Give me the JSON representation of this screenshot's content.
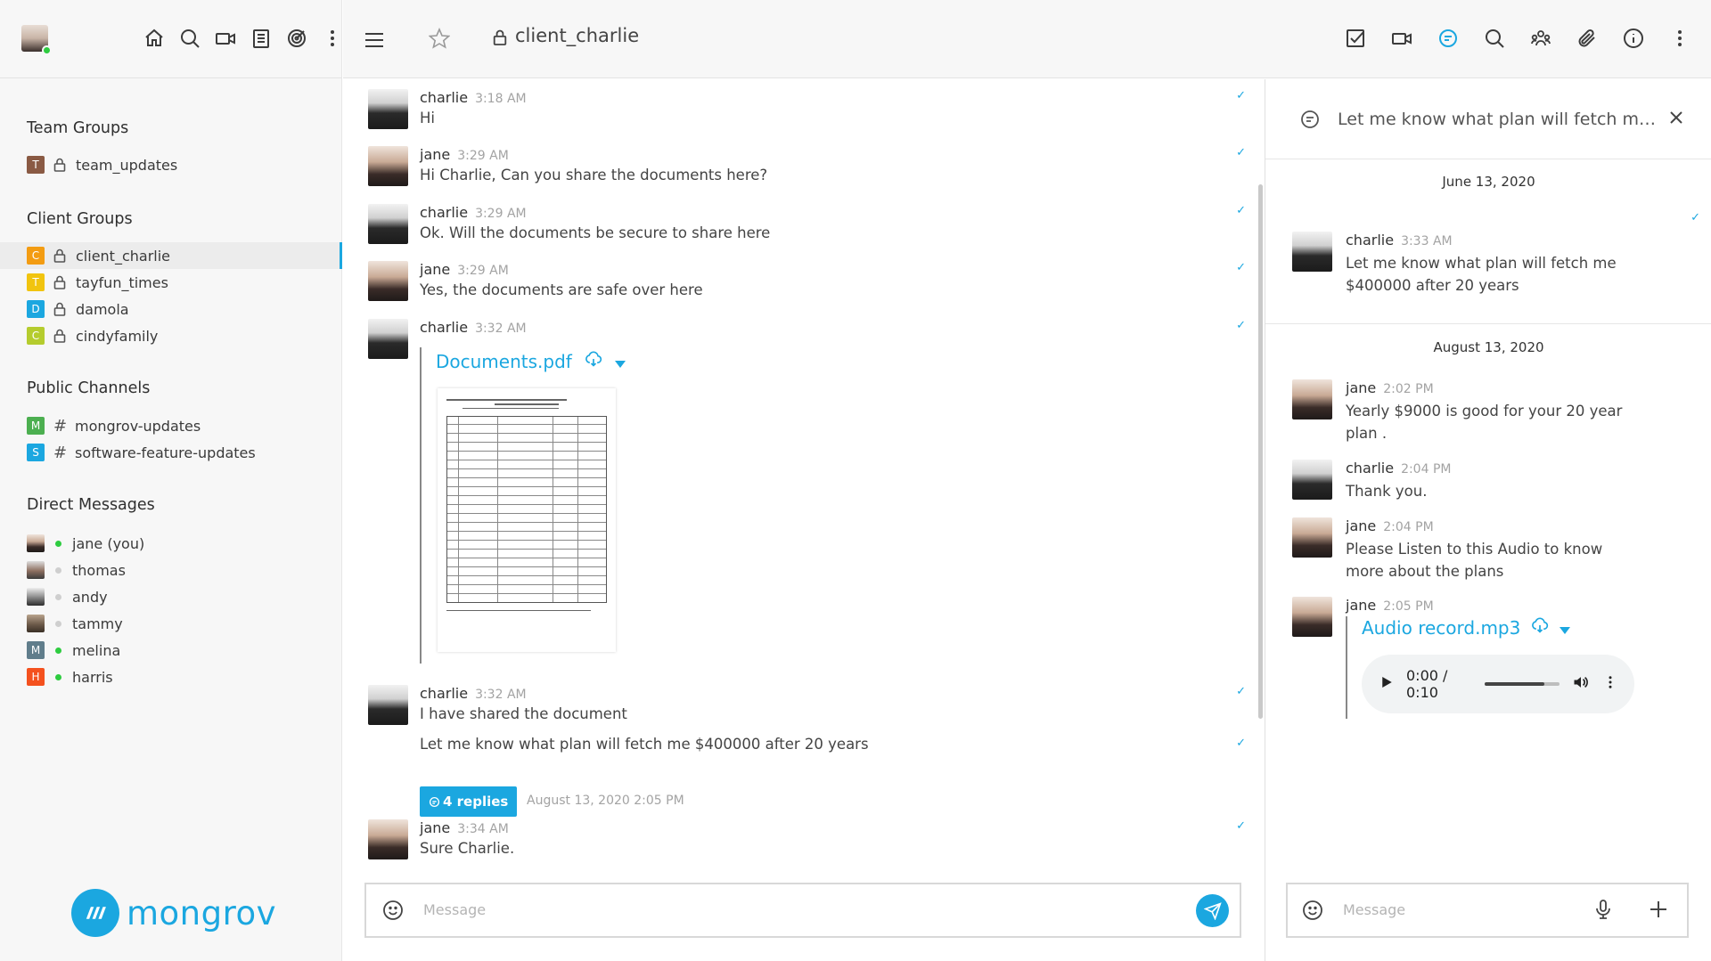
{
  "sidebar": {
    "team_groups_title": "Team Groups",
    "team_groups": [
      {
        "letter": "T",
        "name": "team_updates",
        "color": "#8a5a44"
      }
    ],
    "client_groups_title": "Client Groups",
    "client_groups": [
      {
        "letter": "C",
        "name": "client_charlie",
        "color": "#f39c12"
      },
      {
        "letter": "T",
        "name": "tayfun_times",
        "color": "#f1c40f"
      },
      {
        "letter": "D",
        "name": "damola",
        "color": "#1ba7e0"
      },
      {
        "letter": "C",
        "name": "cindyfamily",
        "color": "#b5cc2e"
      }
    ],
    "public_channels_title": "Public Channels",
    "public_channels": [
      {
        "letter": "M",
        "name": "mongrov-updates",
        "color": "#4caf50"
      },
      {
        "letter": "S",
        "name": "software-feature-updates",
        "color": "#1ba7e0"
      }
    ],
    "direct_messages_title": "Direct Messages",
    "direct_messages": [
      {
        "name": "jane (you)",
        "online": true
      },
      {
        "name": "thomas",
        "online": false
      },
      {
        "name": "andy",
        "online": false
      },
      {
        "name": "tammy",
        "online": false
      },
      {
        "name": "melina",
        "letter": "M",
        "online": true
      },
      {
        "name": "harris",
        "letter": "H",
        "online": true
      }
    ],
    "brand_name": "mongrov"
  },
  "topbar": {
    "channel_name": "client_charlie"
  },
  "messages": [
    {
      "author": "charlie",
      "time": "3:18 AM",
      "text": "Hi"
    },
    {
      "author": "jane",
      "time": "3:29 AM",
      "text": "Hi Charlie, Can you share the documents here?"
    },
    {
      "author": "charlie",
      "time": "3:29 AM",
      "text": "Ok. Will the documents be secure to share here"
    },
    {
      "author": "jane",
      "time": "3:29 AM",
      "text": "Yes, the documents are safe over here"
    },
    {
      "author": "charlie",
      "time": "3:32 AM",
      "attachment": "Documents.pdf"
    },
    {
      "author": "charlie",
      "time": "3:32 AM",
      "text": "I have shared the document",
      "text2": "Let me know what plan will fetch me $400000 after 20 years",
      "replies": "4 replies",
      "replies_date": "August 13, 2020 2:05 PM"
    },
    {
      "author": "jane",
      "time": "3:34 AM",
      "text": "Sure Charlie."
    }
  ],
  "composer": {
    "placeholder": "Message"
  },
  "thread": {
    "title": "Let me know what plan will fetch me...",
    "date1": "June 13, 2020",
    "date2": "August 13, 2020",
    "messages": [
      {
        "author": "charlie",
        "time": "3:33 AM",
        "text": "Let me know what plan will fetch me $400000 after 20 years"
      },
      {
        "author": "jane",
        "time": "2:02 PM",
        "text": "Yearly $9000 is good for your 20 year plan ."
      },
      {
        "author": "charlie",
        "time": "2:04 PM",
        "text": "Thank you."
      },
      {
        "author": "jane",
        "time": "2:04 PM",
        "text": "Please Listen to this Audio to know more about the plans"
      },
      {
        "author": "jane",
        "time": "2:05 PM",
        "attachment": "Audio record.mp3",
        "player_time": "0:00 / 0:10"
      }
    ],
    "composer_placeholder": "Message"
  },
  "colors": {
    "accent": "#1ba7e0",
    "online": "#2ecc40"
  }
}
